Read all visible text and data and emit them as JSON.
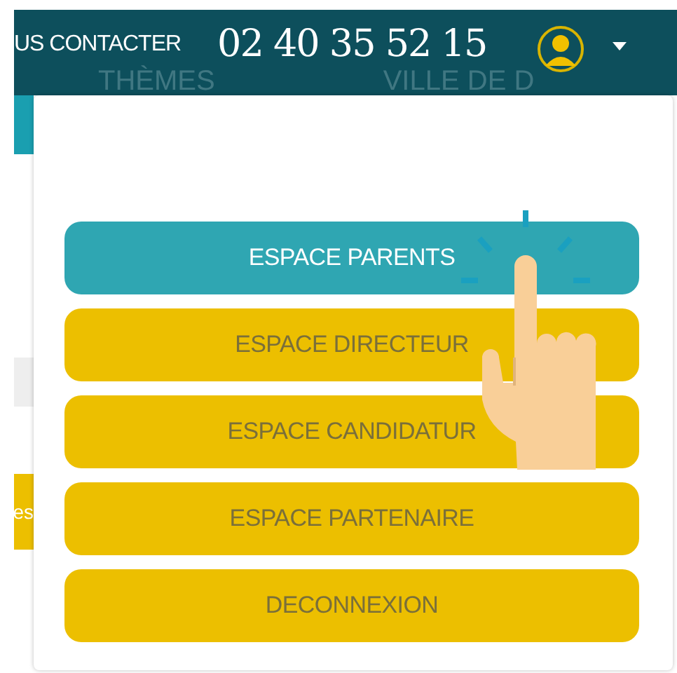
{
  "header": {
    "contact_label": "US CONTACTER",
    "phone": "02 40 35 52 15",
    "nav": [
      "THÈMES",
      "VILLE DE D"
    ]
  },
  "side_tab": {
    "label": "es"
  },
  "menu": [
    {
      "label": "ESPACE PARENTS",
      "selected": true
    },
    {
      "label": "ESPACE DIRECTEUR",
      "selected": false
    },
    {
      "label": "ESPACE CANDIDATUR",
      "selected": false
    },
    {
      "label": "ESPACE PARTENAIRE",
      "selected": false
    },
    {
      "label": "DECONNEXION",
      "selected": false
    }
  ]
}
